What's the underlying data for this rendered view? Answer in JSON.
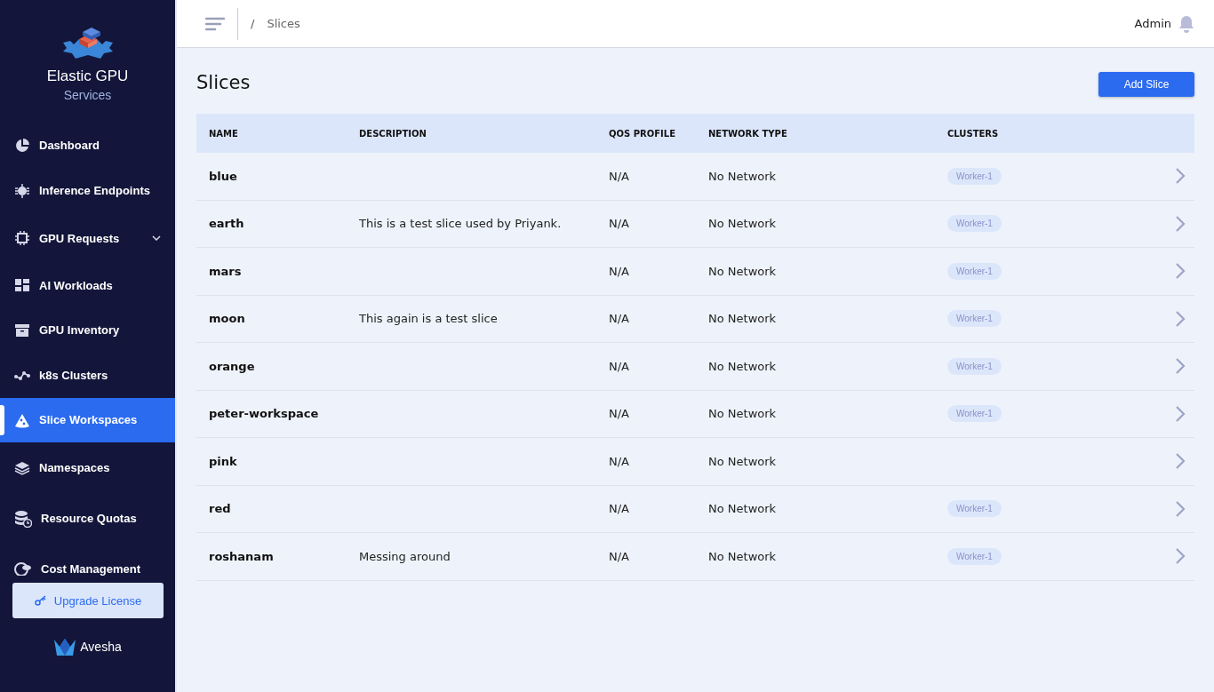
{
  "brand": {
    "title": "Elastic GPU",
    "subtitle": "Services"
  },
  "sidebar": {
    "items": [
      {
        "label": "Dashboard",
        "selected": false
      },
      {
        "label": "Inference Endpoints",
        "selected": false
      },
      {
        "label": "GPU Requests",
        "selected": false,
        "expandable": true
      },
      {
        "label": "AI Workloads",
        "selected": false
      },
      {
        "label": "GPU Inventory",
        "selected": false
      },
      {
        "label": "k8s Clusters",
        "selected": false
      },
      {
        "label": "Slice Workspaces",
        "selected": true
      },
      {
        "label": "Namespaces",
        "selected": false
      },
      {
        "label": "Resource Quotas",
        "selected": false
      },
      {
        "label": "Cost Management",
        "selected": false
      }
    ],
    "upgrade_button": "Upgrade License",
    "footer_logo": "Avesha"
  },
  "header": {
    "breadcrumb_separator": "/",
    "breadcrumb": "Slices",
    "user": "Admin"
  },
  "page": {
    "title": "Slices",
    "add_button": "Add Slice"
  },
  "table": {
    "columns": [
      "NAME",
      "DESCRIPTION",
      "QOS PROFILE",
      "NETWORK TYPE",
      "CLUSTERS"
    ],
    "rows": [
      {
        "name": "blue",
        "description": "",
        "qos": "N/A",
        "network": "No Network",
        "clusters": [
          "Worker-1"
        ]
      },
      {
        "name": "earth",
        "description": "This is a test slice used by Priyank.",
        "qos": "N/A",
        "network": "No Network",
        "clusters": [
          "Worker-1"
        ]
      },
      {
        "name": "mars",
        "description": "",
        "qos": "N/A",
        "network": "No Network",
        "clusters": [
          "Worker-1"
        ]
      },
      {
        "name": "moon",
        "description": "This again is a test slice",
        "qos": "N/A",
        "network": "No Network",
        "clusters": [
          "Worker-1"
        ]
      },
      {
        "name": "orange",
        "description": "",
        "qos": "N/A",
        "network": "No Network",
        "clusters": [
          "Worker-1"
        ]
      },
      {
        "name": "peter-workspace",
        "description": "",
        "qos": "N/A",
        "network": "No Network",
        "clusters": [
          "Worker-1"
        ]
      },
      {
        "name": "pink",
        "description": "",
        "qos": "N/A",
        "network": "No Network",
        "clusters": []
      },
      {
        "name": "red",
        "description": "",
        "qos": "N/A",
        "network": "No Network",
        "clusters": [
          "Worker-1"
        ]
      },
      {
        "name": "roshanam",
        "description": "Messing around",
        "qos": "N/A",
        "network": "No Network",
        "clusters": [
          "Worker-1"
        ]
      }
    ]
  }
}
